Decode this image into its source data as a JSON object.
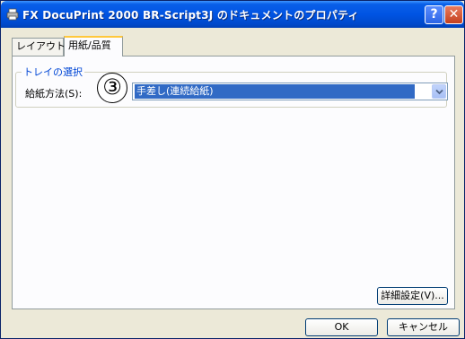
{
  "window": {
    "title": "FX DocuPrint 2000 BR-Script3J のドキュメントのプロパティ",
    "help_label": "?",
    "close_label": "✕"
  },
  "tabs": [
    {
      "label": "レイアウト",
      "selected": false
    },
    {
      "label": "用紙/品質",
      "selected": true
    }
  ],
  "tray_group": {
    "legend": "トレイの選択",
    "feed_label": "給紙方法(S):",
    "callout_number": "③",
    "feed_value": "手差し(連続給紙)"
  },
  "buttons": {
    "advanced": "詳細設定(V)...",
    "ok": "OK",
    "cancel": "キャンセル"
  },
  "colors": {
    "titlebar": "#0054e3",
    "selection": "#316ac5",
    "group_legend": "#0046d5"
  }
}
